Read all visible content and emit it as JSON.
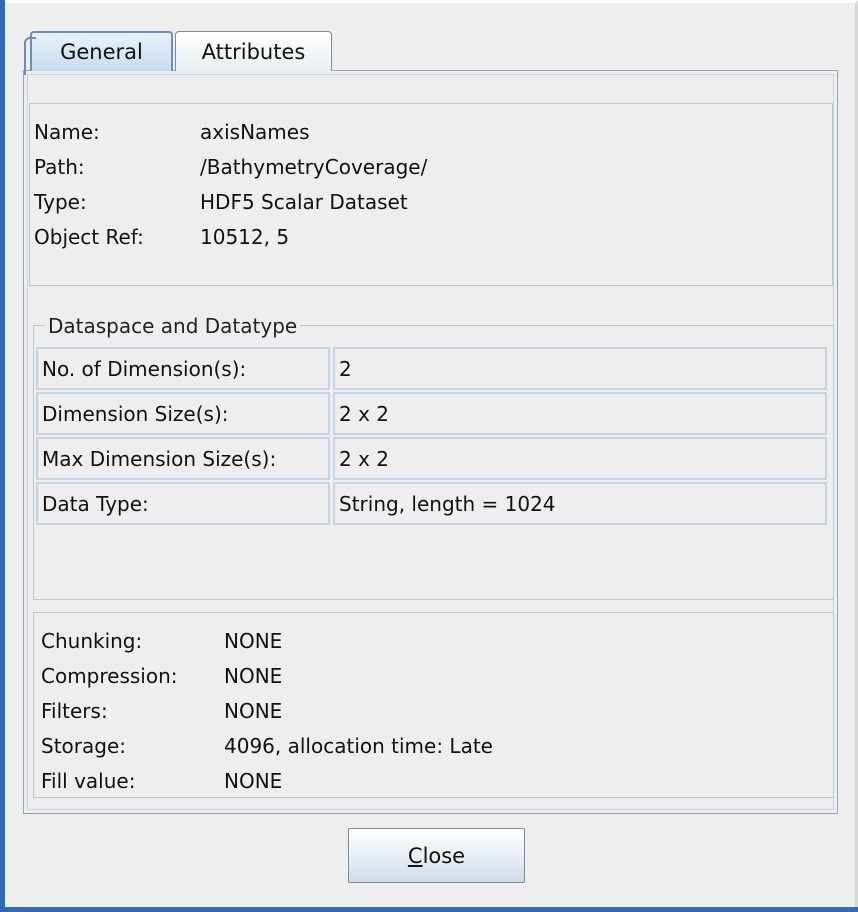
{
  "tabs": [
    {
      "label": "General",
      "selected": true
    },
    {
      "label": "Attributes",
      "selected": false
    }
  ],
  "general": {
    "info": [
      {
        "label": "Name:",
        "value": "axisNames"
      },
      {
        "label": "Path:",
        "value": "/BathymetryCoverage/"
      },
      {
        "label": "Type:",
        "value": "HDF5 Scalar Dataset"
      },
      {
        "label": "Object Ref:",
        "value": "10512, 5"
      }
    ],
    "dataspace": {
      "title": "Dataspace and Datatype",
      "rows": [
        {
          "label": "No. of Dimension(s):",
          "value": "2"
        },
        {
          "label": "Dimension Size(s):",
          "value": "2 x 2"
        },
        {
          "label": "Max Dimension Size(s):",
          "value": "2 x 2"
        },
        {
          "label": "Data Type:",
          "value": "String, length = 1024"
        }
      ]
    },
    "storage": [
      {
        "label": "Chunking:",
        "value": "NONE"
      },
      {
        "label": "Compression:",
        "value": "NONE"
      },
      {
        "label": "Filters:",
        "value": "NONE"
      },
      {
        "label": "Storage:",
        "value": "4096, allocation time: Late"
      },
      {
        "label": "Fill value:",
        "value": "NONE"
      }
    ]
  },
  "buttons": {
    "close_mnemonic": "C",
    "close_rest": "lose"
  },
  "colors": {
    "window_border": "#2f6db3",
    "panel_bg": "#eeeeee",
    "field_border": "#c3d3e2"
  }
}
